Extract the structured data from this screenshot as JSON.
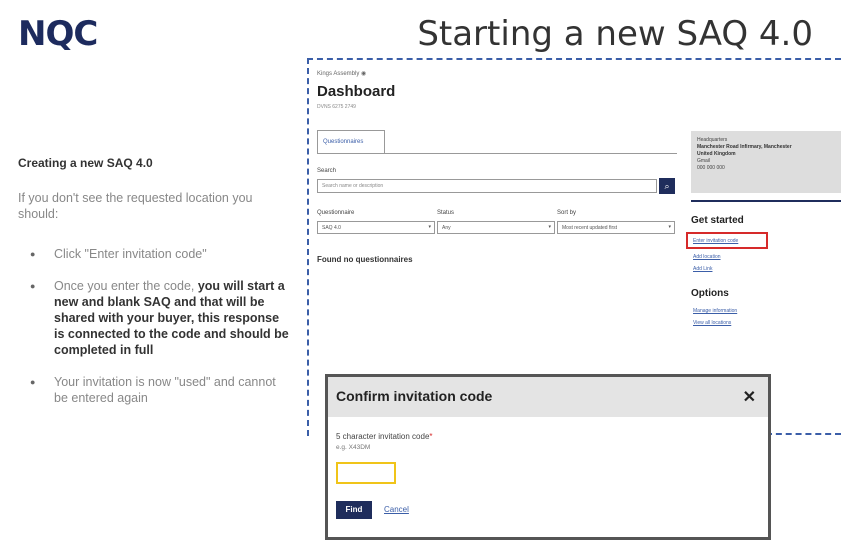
{
  "slide": {
    "logo": "NQC",
    "title": "Starting a new SAQ 4.0"
  },
  "left": {
    "heading": "Creating a new SAQ 4.0",
    "intro": "If you don't see the requested location you should:",
    "bullet1": "Click \"Enter invitation code\"",
    "bullet2_pre": "Once you enter the code, ",
    "bullet2_bold": "you will start a new and blank SAQ and that will be shared with your buyer, this response is connected to the code and should be completed in full",
    "bullet3": "Your invitation is now \"used\" and cannot be entered again"
  },
  "dashboard": {
    "crumb": "Kings Assembly",
    "title": "Dashboard",
    "subtitle": "DVNS 6275 2749",
    "tab": "Questionnaires",
    "search_label": "Search",
    "search_placeholder": "Search name or description",
    "filters": [
      {
        "label": "Questionnaire",
        "value": "SAQ 4.0"
      },
      {
        "label": "Status",
        "value": "Any"
      },
      {
        "label": "Sort by",
        "value": "Most recent updated first"
      }
    ],
    "empty_message": "Found no questionnaires",
    "right_box_lines": [
      "Headquarters",
      "Manchester Road Infirmary, Manchester",
      "United Kingdom",
      "Gmail",
      "000 000 000"
    ],
    "get_started": "Get started",
    "links": [
      "Enter invitation code",
      "Add location",
      "Add Link"
    ],
    "options": "Options",
    "option_links": [
      "Manage information",
      "View all locations"
    ],
    "search_icon": "search-icon"
  },
  "modal": {
    "title": "Confirm invitation code",
    "close_icon": "close-icon",
    "field_label": "5 character invitation code",
    "required_mark": "*",
    "hint": "e.g. X43DM",
    "input_value": "",
    "find_label": "Find",
    "cancel_label": "Cancel"
  },
  "colors": {
    "navy": "#1f2d5c",
    "link": "#3b5ea8",
    "highlight": "#d62a2a",
    "focus": "#f0c419"
  }
}
